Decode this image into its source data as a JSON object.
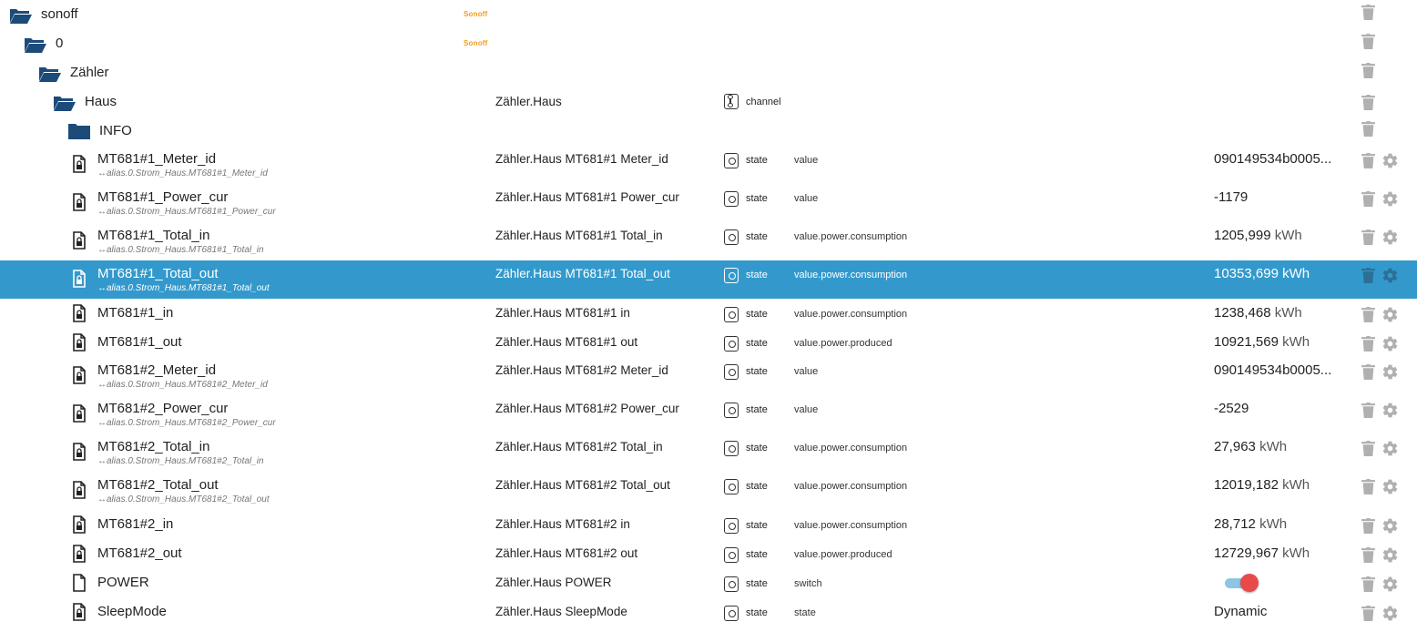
{
  "colors": {
    "selected_row": "#3399cc",
    "folder": "#1c4b7a",
    "logo": "#f29b1d",
    "action_icons": "#b0b0b0",
    "toggle_track": "#8ec5e4",
    "toggle_knob": "#e84a4a"
  },
  "tree": {
    "folders": [
      {
        "label": "sonoff",
        "logo": "Sonoff"
      },
      {
        "label": "0",
        "logo": "Sonoff"
      },
      {
        "label": "Zähler"
      },
      {
        "label": "Haus",
        "name": "Zähler.Haus",
        "type": "channel"
      },
      {
        "label": "INFO"
      }
    ],
    "states": [
      {
        "label": "MT681#1_Meter_id",
        "alias": "↔alias.0.Strom_Haus.MT681#1_Meter_id",
        "name": "Zähler.Haus MT681#1 Meter_id",
        "type": "state",
        "role": "value",
        "value": "090149534b0005...",
        "unit": "",
        "icon": "file-lock-icon"
      },
      {
        "label": "MT681#1_Power_cur",
        "alias": "↔alias.0.Strom_Haus.MT681#1_Power_cur",
        "name": "Zähler.Haus MT681#1 Power_cur",
        "type": "state",
        "role": "value",
        "value": "-1179",
        "unit": "",
        "icon": "file-lock-icon"
      },
      {
        "label": "MT681#1_Total_in",
        "alias": "↔alias.0.Strom_Haus.MT681#1_Total_in",
        "name": "Zähler.Haus MT681#1 Total_in",
        "type": "state",
        "role": "value.power.consumption",
        "value": "1205,999",
        "unit": "kWh",
        "icon": "file-lock-icon"
      },
      {
        "label": "MT681#1_Total_out",
        "alias": "↔alias.0.Strom_Haus.MT681#1_Total_out",
        "name": "Zähler.Haus MT681#1 Total_out",
        "type": "state",
        "role": "value.power.consumption",
        "value": "10353,699",
        "unit": "kWh",
        "selected": true,
        "icon": "file-lock-icon"
      },
      {
        "label": "MT681#1_in",
        "alias": "",
        "name": "Zähler.Haus MT681#1 in",
        "type": "state",
        "role": "value.power.consumption",
        "value": "1238,468",
        "unit": "kWh",
        "icon": "file-lock-icon"
      },
      {
        "label": "MT681#1_out",
        "alias": "",
        "name": "Zähler.Haus MT681#1 out",
        "type": "state",
        "role": "value.power.produced",
        "value": "10921,569",
        "unit": "kWh",
        "icon": "file-lock-icon"
      },
      {
        "label": "MT681#2_Meter_id",
        "alias": "↔alias.0.Strom_Haus.MT681#2_Meter_id",
        "name": "Zähler.Haus MT681#2 Meter_id",
        "type": "state",
        "role": "value",
        "value": "090149534b0005...",
        "unit": "",
        "icon": "file-lock-icon"
      },
      {
        "label": "MT681#2_Power_cur",
        "alias": "↔alias.0.Strom_Haus.MT681#2_Power_cur",
        "name": "Zähler.Haus MT681#2 Power_cur",
        "type": "state",
        "role": "value",
        "value": "-2529",
        "unit": "",
        "icon": "file-lock-icon"
      },
      {
        "label": "MT681#2_Total_in",
        "alias": "↔alias.0.Strom_Haus.MT681#2_Total_in",
        "name": "Zähler.Haus MT681#2 Total_in",
        "type": "state",
        "role": "value.power.consumption",
        "value": "27,963",
        "unit": "kWh",
        "icon": "file-lock-icon"
      },
      {
        "label": "MT681#2_Total_out",
        "alias": "↔alias.0.Strom_Haus.MT681#2_Total_out",
        "name": "Zähler.Haus MT681#2 Total_out",
        "type": "state",
        "role": "value.power.consumption",
        "value": "12019,182",
        "unit": "kWh",
        "icon": "file-lock-icon"
      },
      {
        "label": "MT681#2_in",
        "alias": "",
        "name": "Zähler.Haus MT681#2 in",
        "type": "state",
        "role": "value.power.consumption",
        "value": "28,712",
        "unit": "kWh",
        "icon": "file-lock-icon"
      },
      {
        "label": "MT681#2_out",
        "alias": "",
        "name": "Zähler.Haus MT681#2 out",
        "type": "state",
        "role": "value.power.produced",
        "value": "12729,967",
        "unit": "kWh",
        "icon": "file-lock-icon"
      },
      {
        "label": "POWER",
        "alias": "",
        "name": "Zähler.Haus POWER",
        "type": "state",
        "role": "switch",
        "value": "",
        "unit": "",
        "toggle": true,
        "toggle_on": true,
        "icon": "file-icon"
      },
      {
        "label": "SleepMode",
        "alias": "",
        "name": "Zähler.Haus SleepMode",
        "type": "state",
        "role": "state",
        "value": "Dynamic",
        "unit": "",
        "icon": "file-lock-icon"
      }
    ]
  }
}
